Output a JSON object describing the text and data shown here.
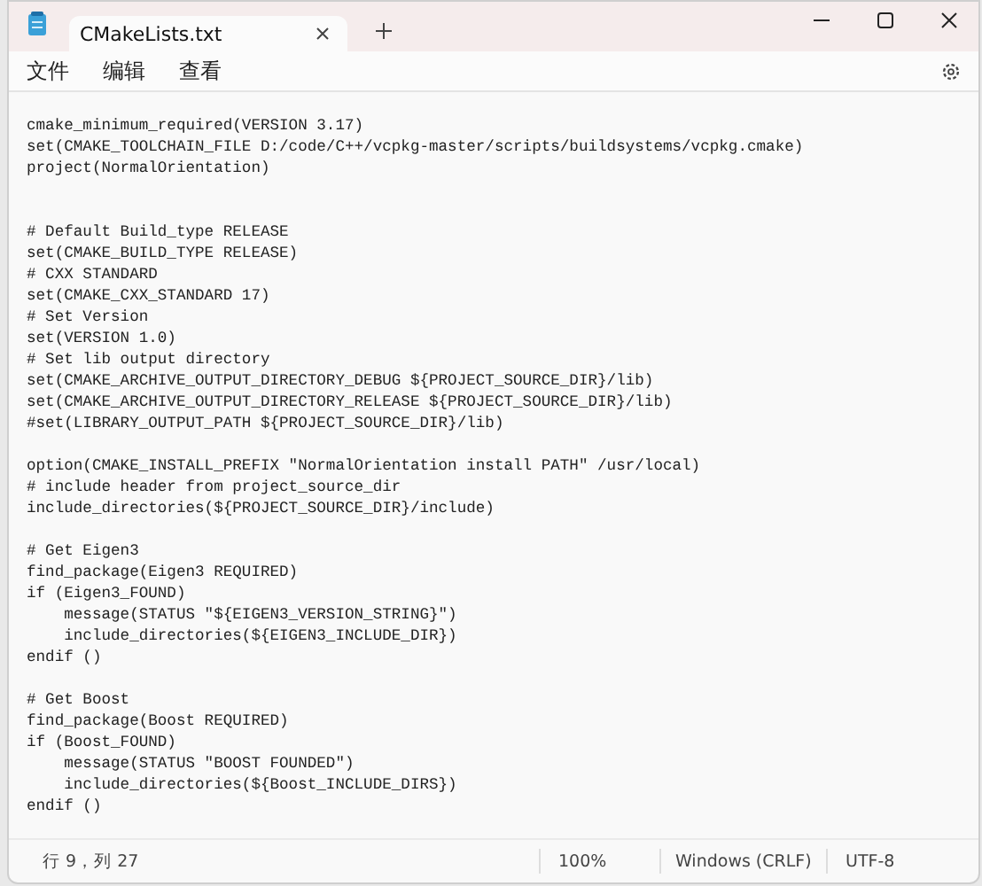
{
  "tabs": [
    {
      "title": "CMakeLists.txt",
      "selected": true
    }
  ],
  "menu": [
    "文件",
    "编辑",
    "查看"
  ],
  "editor": {
    "blocks": [
      [
        "cmake_minimum_required(VERSION 3.17)",
        "set(CMAKE_TOOLCHAIN_FILE D:/code/C++/vcpkg-master/scripts/buildsystems/vcpkg.cmake)",
        "project(NormalOrientation)"
      ],
      [
        "# Default Build_type RELEASE",
        "set(CMAKE_BUILD_TYPE RELEASE)",
        "# CXX STANDARD",
        "set(CMAKE_CXX_STANDARD 17)",
        "# Set Version",
        "set(VERSION 1.0)",
        "# Set lib output directory",
        "set(CMAKE_ARCHIVE_OUTPUT_DIRECTORY_DEBUG ${PROJECT_SOURCE_DIR}/lib)",
        "set(CMAKE_ARCHIVE_OUTPUT_DIRECTORY_RELEASE ${PROJECT_SOURCE_DIR}/lib)",
        "#set(LIBRARY_OUTPUT_PATH ${PROJECT_SOURCE_DIR}/lib)"
      ],
      [
        "option(CMAKE_INSTALL_PREFIX \"NormalOrientation install PATH\" /usr/local)",
        "# include header from project_source_dir",
        "include_directories(${PROJECT_SOURCE_DIR}/include)"
      ],
      [
        "# Get Eigen3",
        "find_package(Eigen3 REQUIRED)",
        "if (Eigen3_FOUND)",
        "    message(STATUS \"${EIGEN3_VERSION_STRING}\")",
        "    include_directories(${EIGEN3_INCLUDE_DIR})",
        "endif ()"
      ],
      [
        "# Get Boost",
        "find_package(Boost REQUIRED)",
        "if (Boost_FOUND)",
        "    message(STATUS \"BOOST FOUNDED\")",
        "    include_directories(${Boost_INCLUDE_DIRS})",
        "endif ()"
      ]
    ]
  },
  "status_bar": {
    "position": "行 9，列 27",
    "zoom": "100%",
    "line_ending": "Windows (CRLF)",
    "encoding": "UTF-8"
  }
}
